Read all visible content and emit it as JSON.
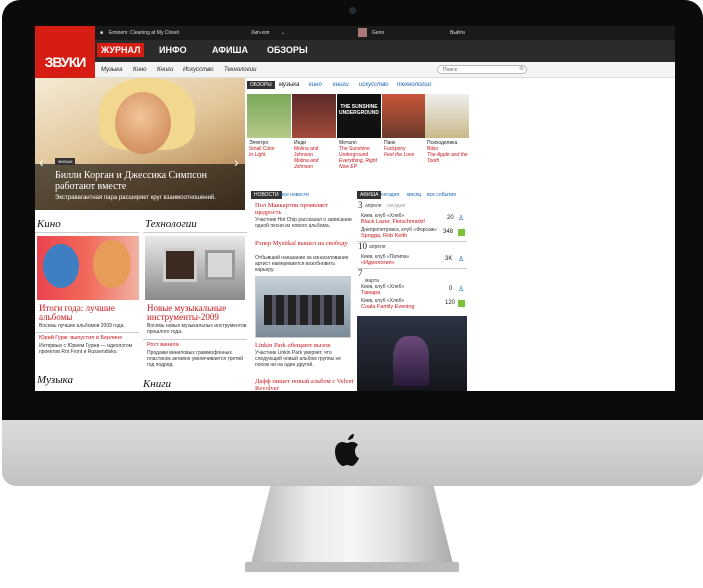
{
  "topbar": {
    "now_playing": "Eminem: Cleaning at My Closet",
    "filter": "Хип-хоп",
    "user": "Genn",
    "logout": "Выйти"
  },
  "logo": "ЗВУКИ",
  "nav": [
    "ЖУРНАЛ",
    "ИНФО",
    "АФИША",
    "ОБЗОРЫ"
  ],
  "subnav": [
    "Музыка",
    "Кино",
    "Книги",
    "Искусство",
    "Технологии"
  ],
  "search_placeholder": "Поиск",
  "hero": {
    "badge": "ФИЛЬМ",
    "title": "Билли Корган и Джессика Симпсон работают вместе",
    "subtitle": "Экстравагантная пара расширяет круг взаимоотношений."
  },
  "kino": {
    "section": "Кино",
    "title": "Итоги года: лучшие альбомы",
    "desc": "Восемь лучших альбомов 2009 года.",
    "sub": "Юрий Гурж: выпустил в Берлине",
    "sub_desc": "Интервью с Юрием Гуржи — идеологом проектов Rot Front и Russendisko."
  },
  "tech": {
    "section": "Технологии",
    "title": "Новые музыкальные инструменты-2009",
    "desc": "Восемь новых музыкальных инструментов прошлого года.",
    "sub": "Рост винила",
    "sub_desc": "Продажи виниловых граммофонных пластинок активно увеличивается третий год подряд."
  },
  "music_section": "Музыка",
  "books_section": "Книги",
  "reviews": {
    "tag": "ОБЗОРЫ",
    "tabs": [
      "музыка",
      "кино",
      "книги",
      "искусство",
      "технологии"
    ],
    "items": [
      {
        "genre": "Электро",
        "artist": "Small Color",
        "album": "In Light"
      },
      {
        "genre": "Инди",
        "artist": "Molina and Johnson",
        "album": "Molina and Johnson"
      },
      {
        "genre": "Металл",
        "artist": "The Sunshine Underground",
        "album": "Everything, Right Now EP"
      },
      {
        "genre": "Панк",
        "artist": "Fuckpony",
        "album": "Feel the Love"
      },
      {
        "genre": "Психоделика",
        "artist": "Bibio",
        "album": "The Apple and the Tooth"
      }
    ]
  },
  "news": {
    "tag": "НОВОСТИ",
    "all": "все новости",
    "items": [
      {
        "title": "Пол Маккартни проявляет щедрость",
        "desc": "Участник Hot Chip рассказал о записании одной песни из нового альбома."
      },
      {
        "title": "Рэпер Mystikal вышел на свободу",
        "desc": "Отбывший наказание за изнасилование артист намеревается возобновить карьеру."
      },
      {
        "title": "Linkin Park обещают вызов",
        "desc": "Участник Linkin Park уверяет, что следующий новый альбом группы не похож ни на один другой."
      },
      {
        "title": "Дафф пишет новый альбом с Velvet Revolver"
      }
    ]
  },
  "afisha": {
    "tag": "АФИША",
    "tabs": [
      "сегодня",
      "месяц",
      "все события"
    ],
    "tab_inactive": "сегодня",
    "days": [
      {
        "num": "3",
        "month": "апреля",
        "day": "сегодня",
        "events": [
          {
            "place": "Киев, клуб «Хлеб»",
            "name": "Black Lazer, Fleischmarkt!",
            "count": "20",
            "icon": "person"
          },
          {
            "place": "Днепропетровск, клуб «Форсаж»",
            "name": "Spogga, Rob Keith",
            "count": "348",
            "icon": "check"
          }
        ]
      },
      {
        "num": "10",
        "month": "апреля",
        "events": [
          {
            "place": "Киев, клуб «Патипа»",
            "name": "«Идеология»",
            "count": "3K",
            "icon": "person"
          }
        ]
      },
      {
        "num": "7",
        "month": "марта",
        "events": [
          {
            "place": "Киев, клуб «Хлеб»",
            "name": "Тамара",
            "count": "0",
            "icon": "person"
          },
          {
            "place": "Киев, клуб «Хлеб»",
            "name": "Coala Family Evening",
            "count": "120",
            "icon": "check"
          }
        ]
      }
    ]
  },
  "colors": {
    "brand": "#d61d14",
    "link": "#1660b8"
  }
}
